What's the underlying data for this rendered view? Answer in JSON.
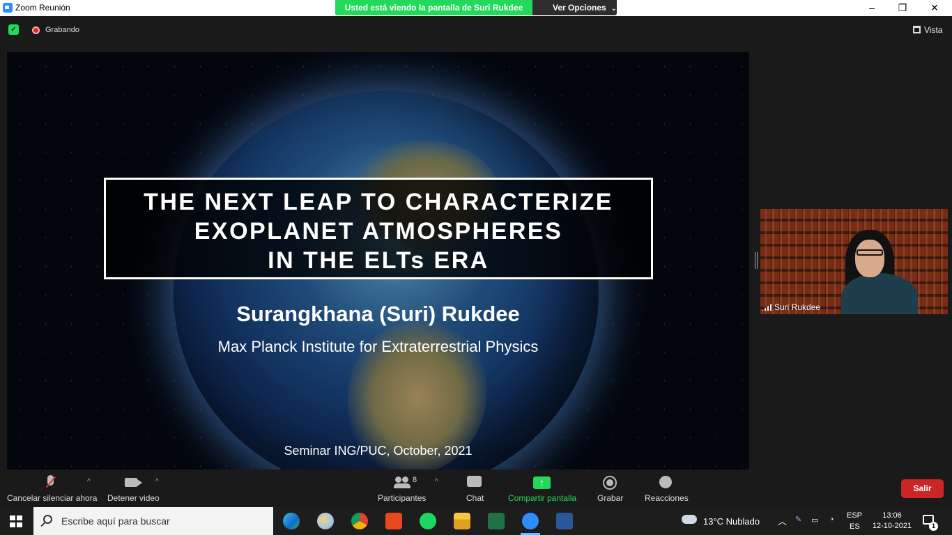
{
  "window": {
    "title": "Zoom Reunión",
    "share_banner": "Usted está viendo la pantalla de Suri Rukdee",
    "view_options": "Ver Opciones",
    "minimize": "–",
    "maximize": "❐",
    "close": "✕"
  },
  "meeting_bar": {
    "recording_label": "Grabando",
    "view_label": "Vista"
  },
  "slide": {
    "title_lines": [
      "THE NEXT LEAP TO CHARACTERIZE",
      "EXOPLANET ATMOSPHERES",
      "IN THE ELTs ERA"
    ],
    "author": "Surangkhana (Suri) Rukdee",
    "institution": "Max Planck Institute for Extraterrestrial Physics",
    "seminar": "Seminar ING/PUC, October, 2021"
  },
  "participant_video": {
    "name": "Suri Rukdee"
  },
  "toolbar": {
    "mute_label": "Cancelar silenciar ahora",
    "video_label": "Detener video",
    "participants_label": "Participantes",
    "participants_count": "8",
    "chat_label": "Chat",
    "share_label": "Compartir pantalla",
    "record_label": "Grabar",
    "reactions_label": "Reacciones",
    "leave_label": "Salir",
    "caret": "^"
  },
  "taskbar": {
    "search_placeholder": "Escribe aquí para buscar",
    "apps": [
      "edge",
      "paint",
      "chrome",
      "office",
      "spotify",
      "file-explorer",
      "excel",
      "zoom",
      "word"
    ],
    "weather": "13°C  Nublado",
    "language_top": "ESP",
    "language_bottom": "ES",
    "time": "13:06",
    "date": "12-10-2021",
    "notification_count": "1"
  }
}
